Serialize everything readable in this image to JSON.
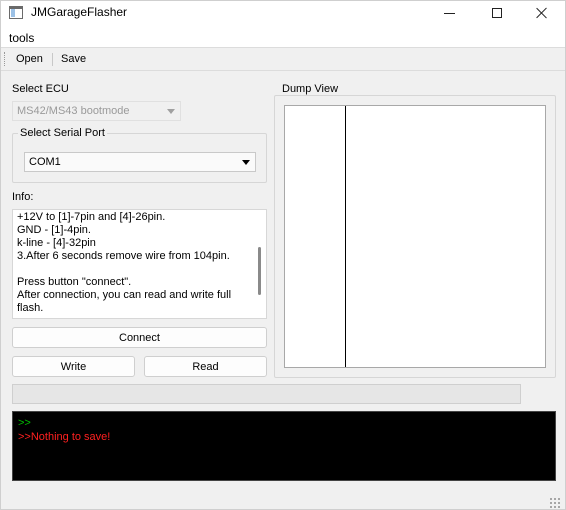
{
  "window": {
    "title": "JMGarageFlasher"
  },
  "menu": {
    "items": [
      {
        "label": "tools"
      }
    ]
  },
  "toolbar": {
    "open_label": "Open",
    "save_label": "Save"
  },
  "ecu": {
    "label": "Select ECU",
    "selected": "MS42/MS43 bootmode",
    "enabled": false
  },
  "serial": {
    "group_title": "Select Serial Port",
    "selected": "COM1"
  },
  "info": {
    "label": "Info:",
    "lines": [
      "+12V to [1]-7pin and [4]-26pin.",
      "GND - [1]-4pin.",
      "k-line - [4]-32pin",
      "3.After 6 seconds remove wire from 104pin.",
      "",
      "Press button \"connect\".",
      "After connection, you can read and write full",
      "flash."
    ]
  },
  "buttons": {
    "connect": "Connect",
    "write": "Write",
    "read": "Read"
  },
  "progress": {
    "value": 0
  },
  "dump": {
    "title": "Dump View"
  },
  "console": {
    "lines": [
      {
        "text": ">>",
        "color": "#00c000"
      },
      {
        "text": ">>Nothing to save!",
        "color": "#ff2020"
      }
    ]
  }
}
